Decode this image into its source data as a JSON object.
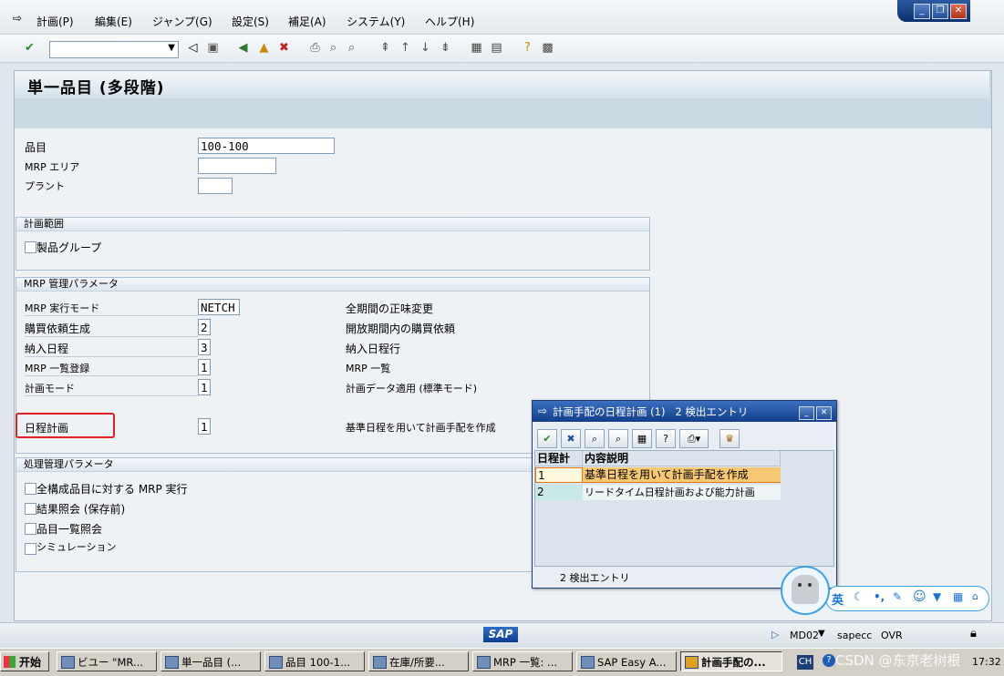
{
  "menubar": {
    "items": [
      "計画(P)",
      "編集(E)",
      "ジャンプ(G)",
      "設定(S)",
      "補足(A)",
      "システム(Y)",
      "ヘルプ(H)"
    ]
  },
  "toolbar": {
    "command_field_value": ""
  },
  "page": {
    "title": "単一品目 (多段階)"
  },
  "header_fields": {
    "item_label": "品目",
    "item_value": "100-100",
    "mrp_area_label": "MRP エリア",
    "mrp_area_value": "",
    "plant_label": "プラント",
    "plant_value": ""
  },
  "planning_scope": {
    "title": "計画範囲",
    "product_group_label": "製品グループ"
  },
  "mrp_params": {
    "title": "MRP 管理パラメータ",
    "rows": [
      {
        "label": "MRP 実行モード",
        "value": "NETCH",
        "desc": "全期間の正味変更"
      },
      {
        "label": "購買依頼生成",
        "value": "2",
        "desc": "開放期間内の購買依頼"
      },
      {
        "label": "納入日程",
        "value": "3",
        "desc": "納入日程行"
      },
      {
        "label": "MRP 一覧登録",
        "value": "1",
        "desc": "MRP 一覧"
      },
      {
        "label": "計画モード",
        "value": "1",
        "desc": "計画データ適用 (標準モード)"
      },
      {
        "label": "日程計画",
        "value": "1",
        "desc": "基準日程を用いて計画手配を作成"
      }
    ]
  },
  "processing_params": {
    "title": "処理管理パラメータ",
    "options": [
      "全構成品目に対する MRP 実行",
      "結果照会 (保存前)",
      "品目一覧照会",
      "シミュレーション"
    ]
  },
  "popup": {
    "title": "計画手配の日程計画 (1)   2 検出エントリ",
    "col_code": "日程計",
    "col_desc": "内容説明",
    "rows": [
      {
        "code": "1",
        "desc": "基準日程を用いて計画手配を作成"
      },
      {
        "code": "2",
        "desc": "リードタイム日程計画および能力計画"
      }
    ],
    "footer": "2 検出エントリ"
  },
  "statusbar": {
    "brand": "SAP",
    "tcode": "MD02",
    "server": "sapecc",
    "mode": "OVR"
  },
  "ime": {
    "lang": "英"
  },
  "taskbar": {
    "start": "开始",
    "tasks": [
      "ビユー \"MR...",
      "単一品目 (...",
      "品目 100-1...",
      "在庫/所要...",
      "MRP 一覧: ...",
      "SAP Easy A...",
      "計画手配の..."
    ],
    "tray_lang": "CH",
    "watermark": "CSDN @东京老树根",
    "clock": "17:32"
  },
  "colors": {
    "accent": "#123f88",
    "highlight_row": "#f7c873",
    "selection_box": "#e02020"
  }
}
